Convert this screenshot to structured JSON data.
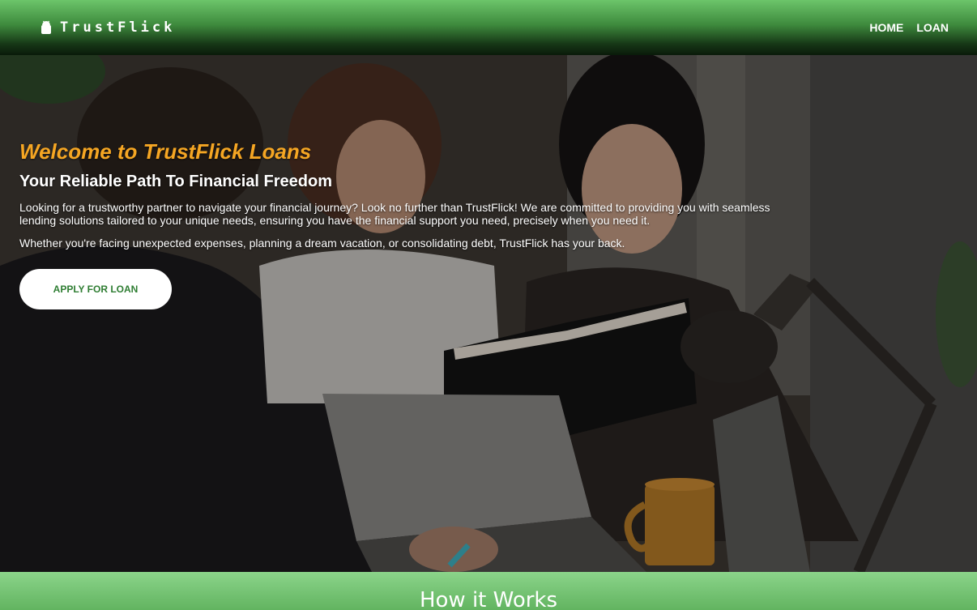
{
  "header": {
    "brand": "TrustFlick",
    "nav": [
      "HOME",
      "LOAN"
    ]
  },
  "hero": {
    "welcome": "Welcome to TrustFlick Loans",
    "tagline": "Your Reliable Path To Financial Freedom",
    "paragraph1": "Looking for a trustworthy partner to navigate your financial journey? Look no further than TrustFlick! We are committed to providing you with seamless lending solutions tailored to your unique needs, ensuring you have the financial support you need, precisely when you need it.",
    "paragraph2": "Whether you're facing unexpected expenses, planning a dream vacation, or consolidating debt, TrustFlick has your back.",
    "cta": "APPLY FOR LOAN"
  },
  "section": {
    "title": "How it Works"
  },
  "colors": {
    "brand_green": "#4caf50",
    "accent_orange": "#f5a623",
    "button_text": "#2e7d32"
  },
  "icons": {
    "logo": "android-logo-icon"
  }
}
